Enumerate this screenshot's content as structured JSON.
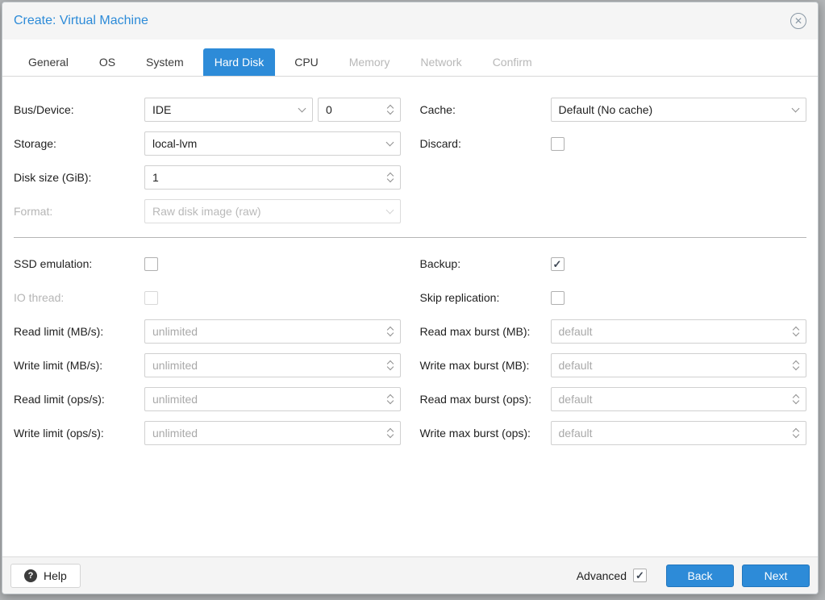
{
  "colors": {
    "accent": "#2d8bd8"
  },
  "window": {
    "title": "Create: Virtual Machine"
  },
  "tabs": [
    {
      "label": "General",
      "state": "normal"
    },
    {
      "label": "OS",
      "state": "normal"
    },
    {
      "label": "System",
      "state": "normal"
    },
    {
      "label": "Hard Disk",
      "state": "active"
    },
    {
      "label": "CPU",
      "state": "normal"
    },
    {
      "label": "Memory",
      "state": "disabled"
    },
    {
      "label": "Network",
      "state": "disabled"
    },
    {
      "label": "Confirm",
      "state": "disabled"
    }
  ],
  "form": {
    "bus_device": {
      "label": "Bus/Device:",
      "value": "IDE",
      "number_value": "0"
    },
    "storage": {
      "label": "Storage:",
      "value": "local-lvm"
    },
    "disk_size": {
      "label": "Disk size (GiB):",
      "value": "1"
    },
    "format": {
      "label": "Format:",
      "value": "Raw disk image (raw)"
    },
    "cache": {
      "label": "Cache:",
      "value": "Default (No cache)"
    },
    "discard": {
      "label": "Discard:",
      "checked": false
    },
    "ssd_emulation": {
      "label": "SSD emulation:",
      "checked": false
    },
    "io_thread": {
      "label": "IO thread:",
      "checked": false
    },
    "backup": {
      "label": "Backup:",
      "checked": true
    },
    "skip_replication": {
      "label": "Skip replication:",
      "checked": false
    },
    "read_limit_mb": {
      "label": "Read limit (MB/s):",
      "placeholder": "unlimited"
    },
    "write_limit_mb": {
      "label": "Write limit (MB/s):",
      "placeholder": "unlimited"
    },
    "read_limit_ops": {
      "label": "Read limit (ops/s):",
      "placeholder": "unlimited"
    },
    "write_limit_ops": {
      "label": "Write limit (ops/s):",
      "placeholder": "unlimited"
    },
    "read_burst_mb": {
      "label": "Read max burst (MB):",
      "placeholder": "default"
    },
    "write_burst_mb": {
      "label": "Write max burst (MB):",
      "placeholder": "default"
    },
    "read_burst_ops": {
      "label": "Read max burst (ops):",
      "placeholder": "default"
    },
    "write_burst_ops": {
      "label": "Write max burst (ops):",
      "placeholder": "default"
    }
  },
  "footer": {
    "help_label": "Help",
    "advanced_label": "Advanced",
    "advanced_checked": true,
    "back_label": "Back",
    "next_label": "Next"
  }
}
